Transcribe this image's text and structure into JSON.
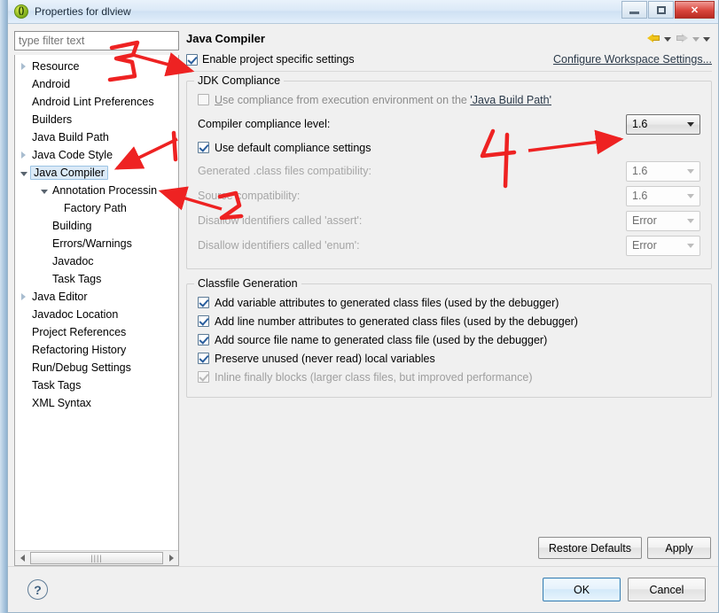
{
  "window": {
    "title": "Properties for dlview",
    "app_icon": "java-properties-icon",
    "minimize_label": "Minimize",
    "maximize_label": "Maximize",
    "close_label": "Close",
    "close_glyph": "✕"
  },
  "sidebar": {
    "filter_placeholder": "type filter text",
    "filter_value": "",
    "items": [
      {
        "label": "Resource",
        "indent": 0,
        "twisty": "collapsed",
        "selected": false
      },
      {
        "label": "Android",
        "indent": 0,
        "twisty": "none",
        "selected": false
      },
      {
        "label": "Android Lint Preferences",
        "indent": 0,
        "twisty": "none",
        "selected": false
      },
      {
        "label": "Builders",
        "indent": 0,
        "twisty": "none",
        "selected": false
      },
      {
        "label": "Java Build Path",
        "indent": 0,
        "twisty": "none",
        "selected": false
      },
      {
        "label": "Java Code Style",
        "indent": 0,
        "twisty": "collapsed",
        "selected": false
      },
      {
        "label": "Java Compiler",
        "indent": 0,
        "twisty": "expanded",
        "selected": true
      },
      {
        "label": "Annotation Processin",
        "indent": 1,
        "twisty": "expanded",
        "selected": false
      },
      {
        "label": "Factory Path",
        "indent": 2,
        "twisty": "none",
        "selected": false
      },
      {
        "label": "Building",
        "indent": 1,
        "twisty": "none",
        "selected": false
      },
      {
        "label": "Errors/Warnings",
        "indent": 1,
        "twisty": "none",
        "selected": false
      },
      {
        "label": "Javadoc",
        "indent": 1,
        "twisty": "none",
        "selected": false
      },
      {
        "label": "Task Tags",
        "indent": 1,
        "twisty": "none",
        "selected": false
      },
      {
        "label": "Java Editor",
        "indent": 0,
        "twisty": "collapsed",
        "selected": false
      },
      {
        "label": "Javadoc Location",
        "indent": 0,
        "twisty": "none",
        "selected": false
      },
      {
        "label": "Project References",
        "indent": 0,
        "twisty": "none",
        "selected": false
      },
      {
        "label": "Refactoring History",
        "indent": 0,
        "twisty": "none",
        "selected": false
      },
      {
        "label": "Run/Debug Settings",
        "indent": 0,
        "twisty": "none",
        "selected": false
      },
      {
        "label": "Task Tags",
        "indent": 0,
        "twisty": "none",
        "selected": false
      },
      {
        "label": "XML Syntax",
        "indent": 0,
        "twisty": "none",
        "selected": false
      }
    ],
    "scroll_left_icon": "scroll-left-arrow",
    "scroll_right_icon": "scroll-right-arrow",
    "scroll_thumb_grip": "||||"
  },
  "page": {
    "title": "Java Compiler",
    "nav": {
      "back_icon": "back-arrow-icon",
      "back_menu_icon": "chevron-down-icon",
      "forward_icon": "forward-arrow-icon",
      "forward_menu_icon": "chevron-down-icon",
      "more_menu_icon": "chevron-down-icon"
    },
    "enable_project_specific": {
      "label": "Enable project specific settings",
      "checked": true
    },
    "configure_workspace_link": "Configure Workspace Settings...",
    "jdk_compliance": {
      "title": "JDK Compliance",
      "use_execution_env": {
        "mnemonic": "U",
        "label_rest": "se compliance from execution environment on the ",
        "link_text": "'Java Build Path'",
        "checked": false,
        "enabled": false
      },
      "compiler_compliance_level": {
        "label": "Compiler compliance level:",
        "value": "1.6",
        "enabled": true
      },
      "use_default_compliance": {
        "label": "Use default compliance settings",
        "checked": true,
        "enabled": true
      },
      "rows": [
        {
          "label": "Generated .class files compatibility:",
          "value": "1.6",
          "enabled": false
        },
        {
          "label": "Source compatibility:",
          "value": "1.6",
          "enabled": false
        },
        {
          "label": "Disallow identifiers called 'assert':",
          "value": "Error",
          "enabled": false
        },
        {
          "label": "Disallow identifiers called 'enum':",
          "value": "Error",
          "enabled": false
        }
      ]
    },
    "classfile_generation": {
      "title": "Classfile Generation",
      "options": [
        {
          "label": "Add variable attributes to generated class files (used by the debugger)",
          "checked": true,
          "enabled": true
        },
        {
          "label": "Add line number attributes to generated class files (used by the debugger)",
          "checked": true,
          "enabled": true
        },
        {
          "label": "Add source file name to generated class file (used by the debugger)",
          "checked": true,
          "enabled": true
        },
        {
          "label": "Preserve unused (never read) local variables",
          "checked": true,
          "enabled": true
        },
        {
          "label": "Inline finally blocks (larger class files, but improved performance)",
          "checked": true,
          "enabled": false
        }
      ]
    },
    "restore_defaults_label": "Restore Defaults",
    "apply_label": "Apply"
  },
  "footer": {
    "help_icon": "help-question-icon",
    "help_glyph": "?",
    "ok_label": "OK",
    "cancel_label": "Cancel"
  },
  "annotations": {
    "color": "#ee2222",
    "marks": [
      {
        "name": "mark-3-filter-to-enable-checkbox",
        "text": "3"
      },
      {
        "name": "mark-1-tree-compiler",
        "text": "1"
      },
      {
        "name": "mark-2-annotation-processing",
        "text": "2"
      },
      {
        "name": "mark-4-compliance-level",
        "text": "4"
      }
    ]
  }
}
